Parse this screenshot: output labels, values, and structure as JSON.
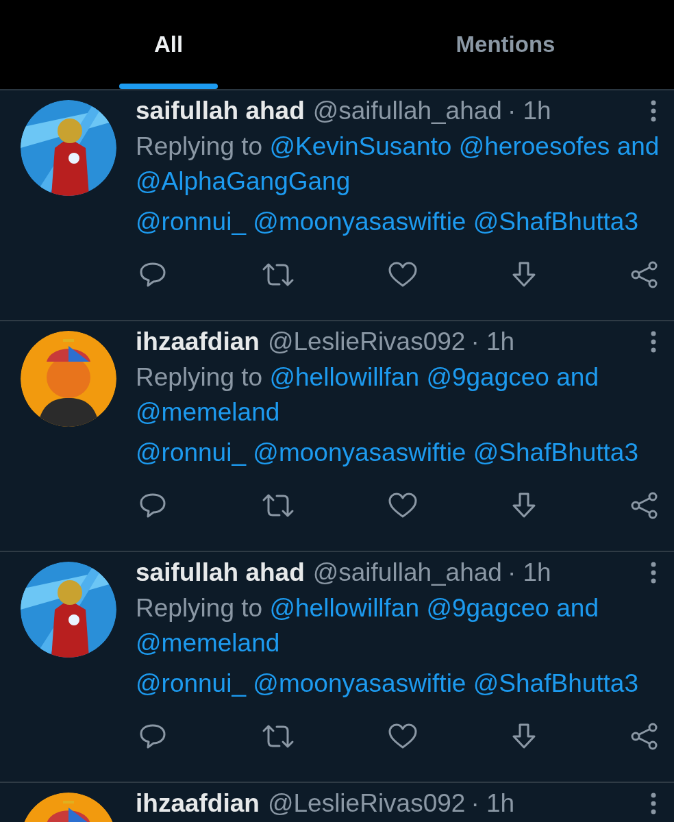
{
  "tabs": [
    {
      "label": "All",
      "selected": true
    },
    {
      "label": "Mentions",
      "selected": false
    }
  ],
  "tweets": [
    {
      "name": "saifullah ahad",
      "handle": "@saifullah_ahad",
      "time": "· 1h",
      "reply": {
        "label": "Replying to",
        "mentions": [
          "@KevinSusanto",
          "@heroesofes"
        ],
        "conjunction": "and",
        "last_mention": "@AlphaGangGang"
      },
      "mentions": [
        "@ronnui_",
        "@moonyasaswiftie",
        "@ShafBhutta3"
      ]
    },
    {
      "name": "ihzaafdian",
      "handle": "@LeslieRivas092",
      "time": "· 1h",
      "reply": {
        "label": "Replying to",
        "mentions": [
          "@hellowillfan",
          "@9gagceo"
        ],
        "conjunction": "and",
        "last_mention": "@memeland"
      },
      "mentions": [
        "@ronnui_",
        "@moonyasaswiftie",
        "@ShafBhutta3"
      ]
    },
    {
      "name": "saifullah ahad",
      "handle": "@saifullah_ahad",
      "time": "· 1h",
      "reply": {
        "label": "Replying to",
        "mentions": [
          "@hellowillfan",
          "@9gagceo"
        ],
        "conjunction": "and",
        "last_mention": "@memeland"
      },
      "mentions": [
        "@ronnui_",
        "@moonyasaswiftie",
        "@ShafBhutta3"
      ]
    },
    {
      "name": "ihzaafdian",
      "handle": "@LeslieRivas092",
      "time": "· 1h"
    }
  ]
}
